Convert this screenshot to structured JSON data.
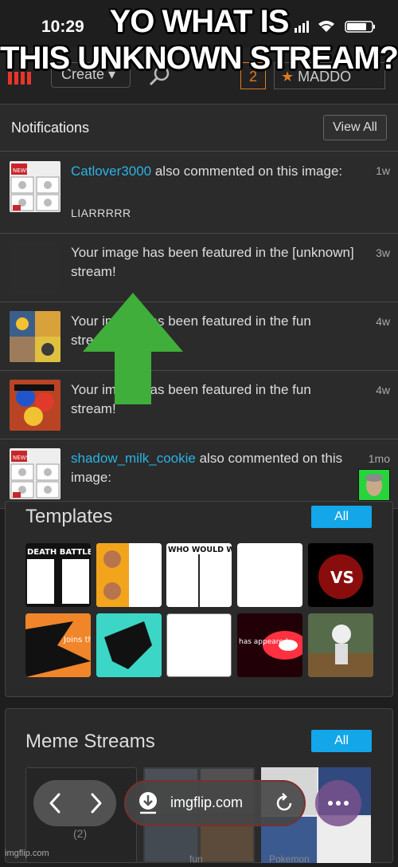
{
  "status_bar": {
    "time": "10:29"
  },
  "caption": {
    "line1": "YO WHAT IS",
    "line2": "THIS UNKNOWN STREAM?"
  },
  "topnav": {
    "create_label": "Create",
    "notif_count": "2",
    "username": "MADDO"
  },
  "notifications": {
    "title": "Notifications",
    "view_all": "View All",
    "items": [
      {
        "user": "Catlover3000",
        "text": " also commented on this image:",
        "time": "1w",
        "comment": "LIARRRRR"
      },
      {
        "text": "Your image has been featured in the [unknown] stream!",
        "time": "3w"
      },
      {
        "text": "Your image has been featured in the fun stream!",
        "time": "4w"
      },
      {
        "text": "Your image has been featured in the fun stream!",
        "time": "4w"
      },
      {
        "user": "shadow_milk_cookie",
        "text": " also commented on this image:",
        "time": "1mo"
      }
    ]
  },
  "templates": {
    "title": "Templates",
    "all_label": "All",
    "tiles": [
      {
        "label": "DEATH BATTLE"
      },
      {
        "label": ""
      },
      {
        "label": "WHO WOULD WIN"
      },
      {
        "label": ""
      },
      {
        "label": "VS"
      },
      {
        "label": "Joins the"
      },
      {
        "label": ""
      },
      {
        "label": ""
      },
      {
        "label": "has appeared"
      },
      {
        "label": ""
      }
    ]
  },
  "meme_streams": {
    "title": "Meme Streams",
    "all_label": "All",
    "labels": [
      "fun",
      "Pokemon"
    ],
    "count": "(2)"
  },
  "browser": {
    "url": "imgflip.com"
  },
  "footer": "imgflip.com",
  "colors": {
    "link": "#2ab3e6",
    "accent": "#13a6e8",
    "arrow": "#3fae3a"
  }
}
